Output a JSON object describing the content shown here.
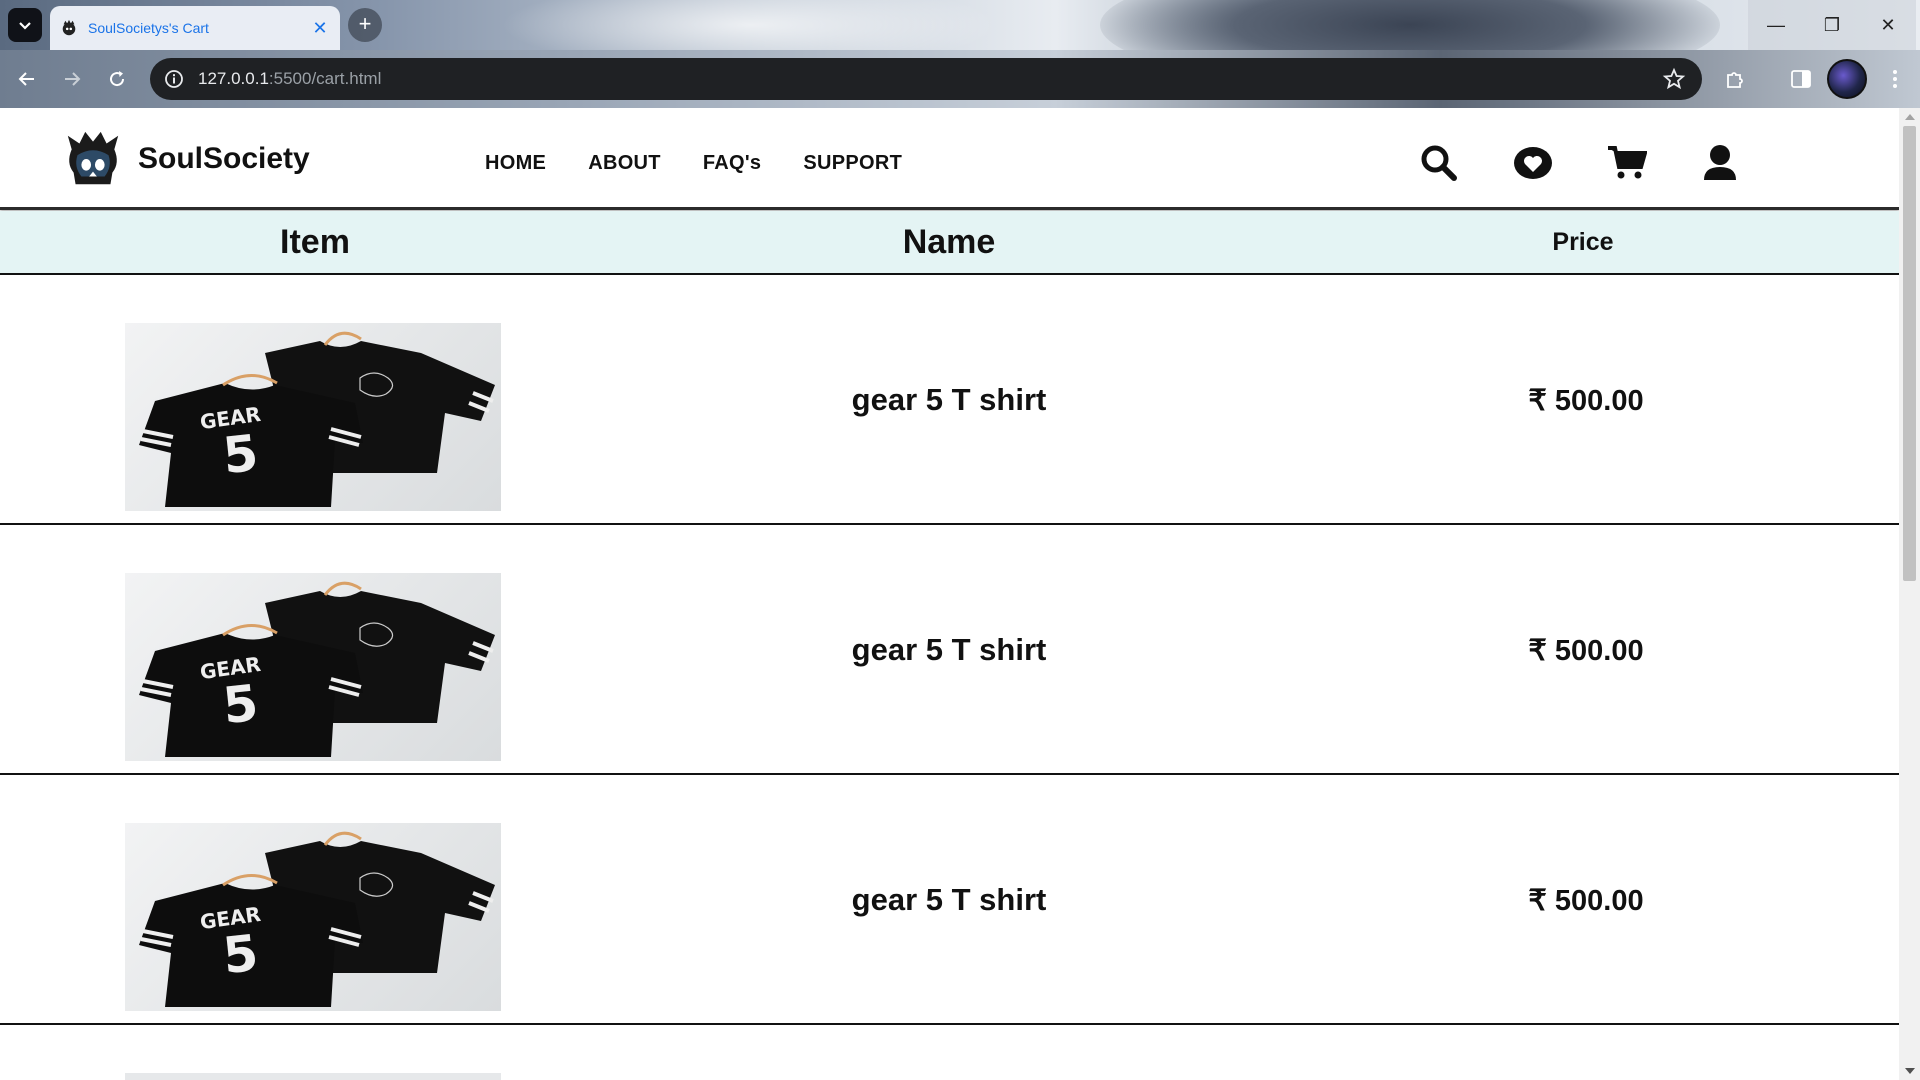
{
  "browser": {
    "tab_title": "SoulSocietys's Cart",
    "url_host": "127.0.0.1",
    "url_rest": ":5500/cart.html",
    "icons": [
      "tab-search-icon",
      "close-icon",
      "plus-icon",
      "back-icon",
      "forward-icon",
      "reload-icon",
      "info-icon",
      "star-icon",
      "extensions-icon",
      "side-panel-icon",
      "more-vert-icon"
    ]
  },
  "site": {
    "brand": "SoulSociety",
    "nav": [
      "HOME",
      "ABOUT",
      "FAQ's",
      "SUPPORT"
    ],
    "header_icons": [
      "search-icon",
      "heart-icon",
      "cart-icon",
      "user-icon"
    ]
  },
  "cart": {
    "columns": {
      "item": "Item",
      "name": "Name",
      "price": "Price"
    },
    "rows": [
      {
        "image": "gear-5-tshirt-image",
        "name": "gear 5 T shirt",
        "price": "₹ 500.00"
      },
      {
        "image": "gear-5-tshirt-image",
        "name": "gear 5 T shirt",
        "price": "₹ 500.00"
      },
      {
        "image": "gear-5-tshirt-image",
        "name": "gear 5 T shirt",
        "price": "₹ 500.00"
      }
    ],
    "header_bg": "#e4f4f4"
  }
}
